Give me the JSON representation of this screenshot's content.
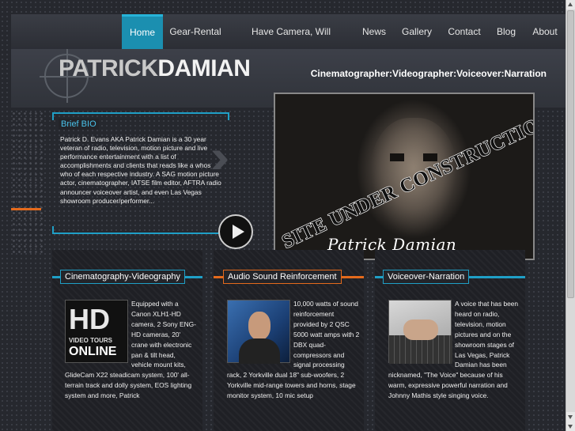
{
  "nav": {
    "items": [
      {
        "label": "Home",
        "active": true
      },
      {
        "label": "Gear-Rental"
      },
      {
        "label": "Have Camera, Will Travel..."
      },
      {
        "label": "News"
      },
      {
        "label": "Gallery"
      },
      {
        "label": "Contact"
      },
      {
        "label": "Blog"
      },
      {
        "label": "About"
      }
    ]
  },
  "header": {
    "logo_first": "PATRICK",
    "logo_last": "DAMIAN",
    "tagline": "Cinematographer:Videographer:Voiceover:Narration"
  },
  "bio": {
    "title": "Brief BIO",
    "text": "Patrick D. Evans AKA Patrick Damian is a 30 year veteran of radio, television, motion picture and live performance entertainment with a list of accomplishments and clients that reads like a whos who of each respective industry.  A SAG motion picture actor, cinematographer, IATSE film editor, AFTRA radio announcer voiceover artist, and even Las Vegas showroom producer/performer..."
  },
  "hero": {
    "stamp": "SITE UNDER CONSTRUCTION",
    "signature": "Patrick Damian"
  },
  "boxes": [
    {
      "title": "Cinematography-Videography",
      "accent": "#1f9fc6",
      "thumb_lines": [
        "HD",
        "VIDEO TOURS",
        "ONLINE"
      ],
      "text": "Equipped with a  Canon XLH1-HD camera, 2 Sony ENG-HD cameras, 20' crane with electronic pan & tilt head, vehicle mount kits, GlideCam X22 steadicam system, 100' all-terrain track and dolly system, EOS lighting system and more, Patrick"
    },
    {
      "title": "Audio Sound Reinforcement",
      "accent": "#e46a1c",
      "text": "10,000 watts of sound reinforcement provided by  2 QSC 5000 watt amps with 2 DBX quad-compressors and signal processing rack, 2 Yorkville dual 18\" sub-woofers, 2 Yorkville mid-range towers and horns, stage monitor system, 10 mic setup"
    },
    {
      "title": "Voiceover-Narration",
      "accent": "#1f9fc6",
      "text": "A voice that has been heard on radio, television, motion pictures and on the showroom stages of Las Vegas, Patrick Damian has been nicknamed, \"The Voice\" because of his warm, expressive powerful narration and Johnny Mathis style singing voice."
    }
  ],
  "colors": {
    "accent_blue": "#1f9fc6",
    "accent_orange": "#e46a1c",
    "background": "#26282e"
  }
}
